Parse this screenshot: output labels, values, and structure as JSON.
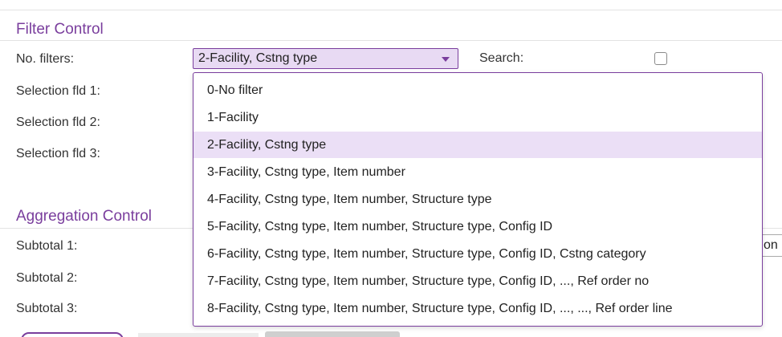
{
  "filter_control": {
    "title": "Filter Control",
    "labels": {
      "no_filters": "No. filters:",
      "selection_fld_1": "Selection fld 1:",
      "selection_fld_2": "Selection fld 2:",
      "selection_fld_3": "Selection fld 3:"
    },
    "no_filters_select": {
      "value": "2-Facility, Cstng type",
      "options": [
        "0-No filter",
        "1-Facility",
        "2-Facility, Cstng type",
        "3-Facility, Cstng type, Item number",
        "4-Facility, Cstng type, Item number, Structure type",
        "5-Facility, Cstng type, Item number, Structure type, Config ID",
        "6-Facility, Cstng type, Item number, Structure type, Config ID, Cstng category",
        "7-Facility, Cstng type, Item number, Structure type, Config ID, ..., Ref order no",
        "8-Facility, Cstng type, Item number, Structure type, Config ID, ..., ..., Ref order line"
      ],
      "selected_index": 2
    },
    "search": {
      "label": "Search:",
      "checked": false
    }
  },
  "aggregation_control": {
    "title": "Aggregation Control",
    "labels": {
      "subtotal_1": "Subtotal 1:",
      "subtotal_2": "Subtotal 2:",
      "subtotal_3": "Subtotal 3:"
    },
    "subtotal_1_partial_value": "on"
  },
  "colors": {
    "accent": "#7a3e9d",
    "selected_background": "#ebdff6",
    "select_background": "#e8daf3",
    "text": "#333333"
  },
  "icons": {
    "dropdown_caret": "chevron-down-icon",
    "search_checkbox": "checkbox-icon"
  }
}
